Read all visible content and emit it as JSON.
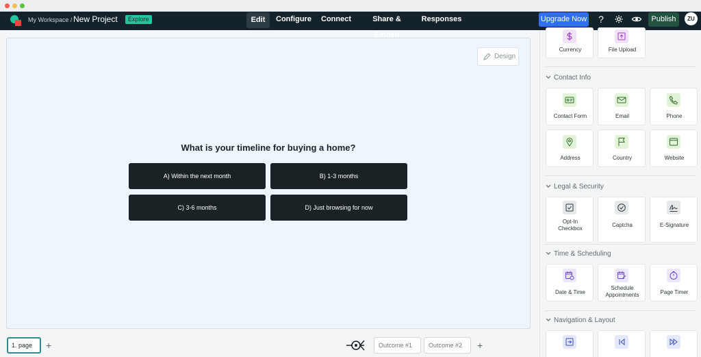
{
  "topbar": {
    "workspace": "My Workspace /",
    "project": "New Project",
    "badge": "Explore",
    "tabs": [
      "Edit",
      "Configure",
      "Connect",
      "Share & Embed",
      "Responses"
    ],
    "upgrade": "Upgrade Now",
    "help": "?",
    "publish": "Publish",
    "avatar": "ZU"
  },
  "canvas": {
    "design": "Design",
    "question": "What is your timeline for buying a home?",
    "answers": [
      "A) Within the next month",
      "B) 1-3 months",
      "C) 3-6 months",
      "D) Just browsing for now"
    ]
  },
  "bottom": {
    "page": "1. page",
    "plus": "+",
    "outcomes": [
      "Outcome #1",
      "Outcome #2"
    ]
  },
  "sidebar": {
    "top_items": [
      "Currency",
      "File Upload"
    ],
    "sections": [
      {
        "title": "Contact Info",
        "items": [
          "Contact Form",
          "Email",
          "Phone",
          "Address",
          "Country",
          "Website"
        ]
      },
      {
        "title": "Legal & Security",
        "items": [
          "Opt-In Checkbox",
          "Captcha",
          "E-Signature"
        ]
      },
      {
        "title": "Time & Scheduling",
        "items": [
          "Date & Time",
          "Schedule Appointments",
          "Page Timer"
        ]
      },
      {
        "title": "Navigation & Layout",
        "items": [
          "",
          "",
          ""
        ]
      }
    ]
  },
  "colors": {
    "topbar": "#14232b",
    "accent_blue": "#2f6ff0",
    "publish_green": "#23523e",
    "explore_badge": "#22c5a0",
    "canvas_bg": "#eef5fc",
    "answer_bg": "#1a2226"
  },
  "icons": {
    "currency": "dollar-icon",
    "file_upload": "upload-icon",
    "contact_form": "id-card-icon",
    "email": "envelope-icon",
    "phone": "phone-icon",
    "address": "map-pin-icon",
    "country": "flag-icon",
    "website": "browser-icon",
    "opt_in": "checkbox-icon",
    "captcha": "check-circle-icon",
    "signature": "signature-icon",
    "date_time": "calendar-clock-icon",
    "schedule": "calendar-edit-icon",
    "timer": "timer-icon",
    "nav1": "arrow-right-box-icon",
    "nav2": "skip-back-icon",
    "nav3": "fast-forward-icon"
  }
}
